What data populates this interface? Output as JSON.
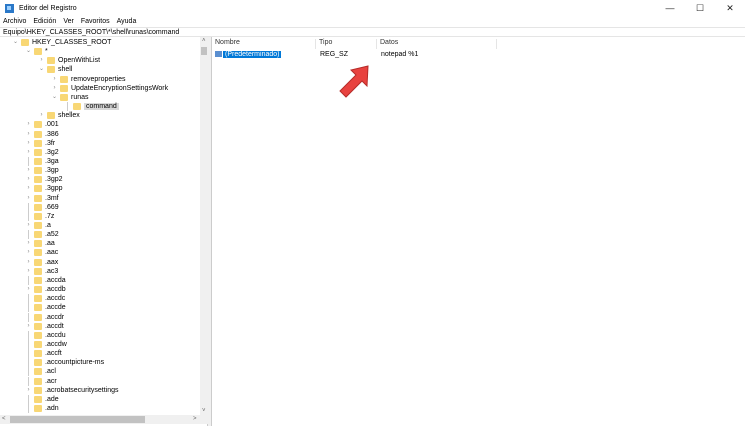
{
  "window": {
    "title": "Editor del Registro",
    "minimize": "—",
    "maximize": "☐",
    "close": "✕"
  },
  "menu": [
    "Archivo",
    "Edición",
    "Ver",
    "Favoritos",
    "Ayuda"
  ],
  "address": "Equipo\\HKEY_CLASSES_ROOT\\*\\shell\\runas\\command",
  "tree": [
    {
      "label": "HKEY_CLASSES_ROOT",
      "level": 0,
      "exp": "open"
    },
    {
      "label": "*",
      "level": 1,
      "exp": "open"
    },
    {
      "label": "OpenWithList",
      "level": 2,
      "exp": "closed"
    },
    {
      "label": "shell",
      "level": 2,
      "exp": "open"
    },
    {
      "label": "removeproperties",
      "level": 3,
      "exp": "closed"
    },
    {
      "label": "UpdateEncryptionSettingsWork",
      "level": 3,
      "exp": "closed"
    },
    {
      "label": "runas",
      "level": 3,
      "exp": "open"
    },
    {
      "label": "command",
      "level": 4,
      "exp": "none",
      "selected": true
    },
    {
      "label": "shellex",
      "level": 2,
      "exp": "closed"
    },
    {
      "label": ".001",
      "level": 1,
      "exp": "closed"
    },
    {
      "label": ".386",
      "level": 1,
      "exp": "closed"
    },
    {
      "label": ".3fr",
      "level": 1,
      "exp": "closed"
    },
    {
      "label": ".3g2",
      "level": 1,
      "exp": "closed"
    },
    {
      "label": ".3ga",
      "level": 1,
      "exp": "none"
    },
    {
      "label": ".3gp",
      "level": 1,
      "exp": "closed"
    },
    {
      "label": ".3gp2",
      "level": 1,
      "exp": "closed"
    },
    {
      "label": ".3gpp",
      "level": 1,
      "exp": "closed"
    },
    {
      "label": ".3mf",
      "level": 1,
      "exp": "closed"
    },
    {
      "label": ".669",
      "level": 1,
      "exp": "none"
    },
    {
      "label": ".7z",
      "level": 1,
      "exp": "none"
    },
    {
      "label": ".a",
      "level": 1,
      "exp": "closed"
    },
    {
      "label": ".a52",
      "level": 1,
      "exp": "none"
    },
    {
      "label": ".aa",
      "level": 1,
      "exp": "closed"
    },
    {
      "label": ".aac",
      "level": 1,
      "exp": "closed"
    },
    {
      "label": ".aax",
      "level": 1,
      "exp": "closed"
    },
    {
      "label": ".ac3",
      "level": 1,
      "exp": "closed"
    },
    {
      "label": ".accda",
      "level": 1,
      "exp": "none"
    },
    {
      "label": ".accdb",
      "level": 1,
      "exp": "closed"
    },
    {
      "label": ".accdc",
      "level": 1,
      "exp": "none"
    },
    {
      "label": ".accde",
      "level": 1,
      "exp": "none"
    },
    {
      "label": ".accdr",
      "level": 1,
      "exp": "none"
    },
    {
      "label": ".accdt",
      "level": 1,
      "exp": "closed"
    },
    {
      "label": ".accdu",
      "level": 1,
      "exp": "none"
    },
    {
      "label": ".accdw",
      "level": 1,
      "exp": "none"
    },
    {
      "label": ".accft",
      "level": 1,
      "exp": "none"
    },
    {
      "label": ".accountpicture-ms",
      "level": 1,
      "exp": "none"
    },
    {
      "label": ".acl",
      "level": 1,
      "exp": "none"
    },
    {
      "label": ".acr",
      "level": 1,
      "exp": "none"
    },
    {
      "label": ".acrobatsecuritysettings",
      "level": 1,
      "exp": "closed"
    },
    {
      "label": ".ade",
      "level": 1,
      "exp": "none"
    },
    {
      "label": ".adn",
      "level": 1,
      "exp": "none"
    }
  ],
  "list": {
    "columns": [
      "Nombre",
      "Tipo",
      "Datos"
    ],
    "rows": [
      {
        "name": "(Predeterminado)",
        "type": "REG_SZ",
        "data": "notepad %1"
      }
    ]
  },
  "colors": {
    "selection": "#0078d7",
    "folder": "#f8d775",
    "arrow": "#e8423f"
  }
}
